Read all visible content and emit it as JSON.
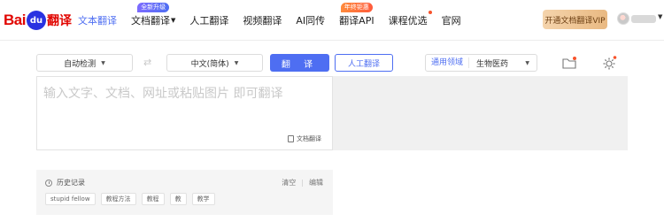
{
  "brand": {
    "logo_bai": "Bai",
    "logo_du": "du",
    "logo_fanyi": "翻译",
    "color_red": "#e10601",
    "color_blue": "#2932e1"
  },
  "nav": {
    "items": [
      {
        "label": "文本翻译",
        "active": true
      },
      {
        "label": "文档翻译",
        "badge": "全新升级",
        "has_caret": true
      },
      {
        "label": "人工翻译"
      },
      {
        "label": "视频翻译"
      },
      {
        "label": "AI同传"
      },
      {
        "label": "翻译API",
        "badge": "年终钜惠"
      },
      {
        "label": "课程优选",
        "dot": true
      },
      {
        "label": "官网"
      }
    ],
    "vip_button": "开通文档翻译VIP"
  },
  "toolbar": {
    "source_lang": "自动检测",
    "target_lang": "中文(简体)",
    "translate_button": "翻 译",
    "human_translate_button": "人工翻译",
    "domain_label": "通用领域",
    "domain_value": "生物医药"
  },
  "input": {
    "placeholder": "输入文字、文档、网址或粘贴图片 即可翻译",
    "doc_translate_link": "文档翻译"
  },
  "history": {
    "title": "历史记录",
    "clear": "清空",
    "edit": "编辑",
    "entries": [
      "stupid fellow",
      "教程方法",
      "教程",
      "教",
      "教学"
    ]
  },
  "colors": {
    "accent": "#4e6ef2",
    "vip_gold": "#e9b982",
    "output_bg": "#f0f0f0"
  }
}
